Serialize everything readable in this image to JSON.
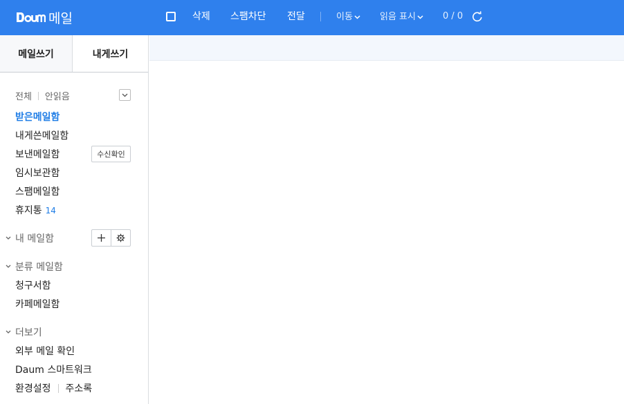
{
  "brand": {
    "logo_text": "Daum",
    "service": "메일"
  },
  "toolbar": {
    "delete": "삭제",
    "spam_block": "스팸차단",
    "forward": "전달",
    "move": "이동",
    "mark_read": "읽음 표시",
    "counter": "0 / 0"
  },
  "compose": {
    "write": "메일쓰기",
    "write_to_me": "내게쓰기"
  },
  "filter": {
    "all": "전체",
    "unread": "안읽음"
  },
  "folders": [
    {
      "label": "받은메일함"
    },
    {
      "label": "내게쓴메일함"
    },
    {
      "label": "보낸메일함",
      "action": "수신확인"
    },
    {
      "label": "임시보관함"
    },
    {
      "label": "스팸메일함"
    },
    {
      "label": "휴지통",
      "count": "14"
    }
  ],
  "my_mailbox": {
    "title": "내 메일함"
  },
  "category": {
    "title": "분류 메일함",
    "items": [
      "청구서함",
      "카페메일함"
    ]
  },
  "more": {
    "title": "더보기",
    "items": [
      "외부 메일 확인",
      "Daum 스마트워크"
    ],
    "settings": "환경설정",
    "address_book": "주소록"
  },
  "colors": {
    "header": "#2f80ed",
    "accent": "#1f7de6",
    "strip": "#f3f7fd"
  }
}
